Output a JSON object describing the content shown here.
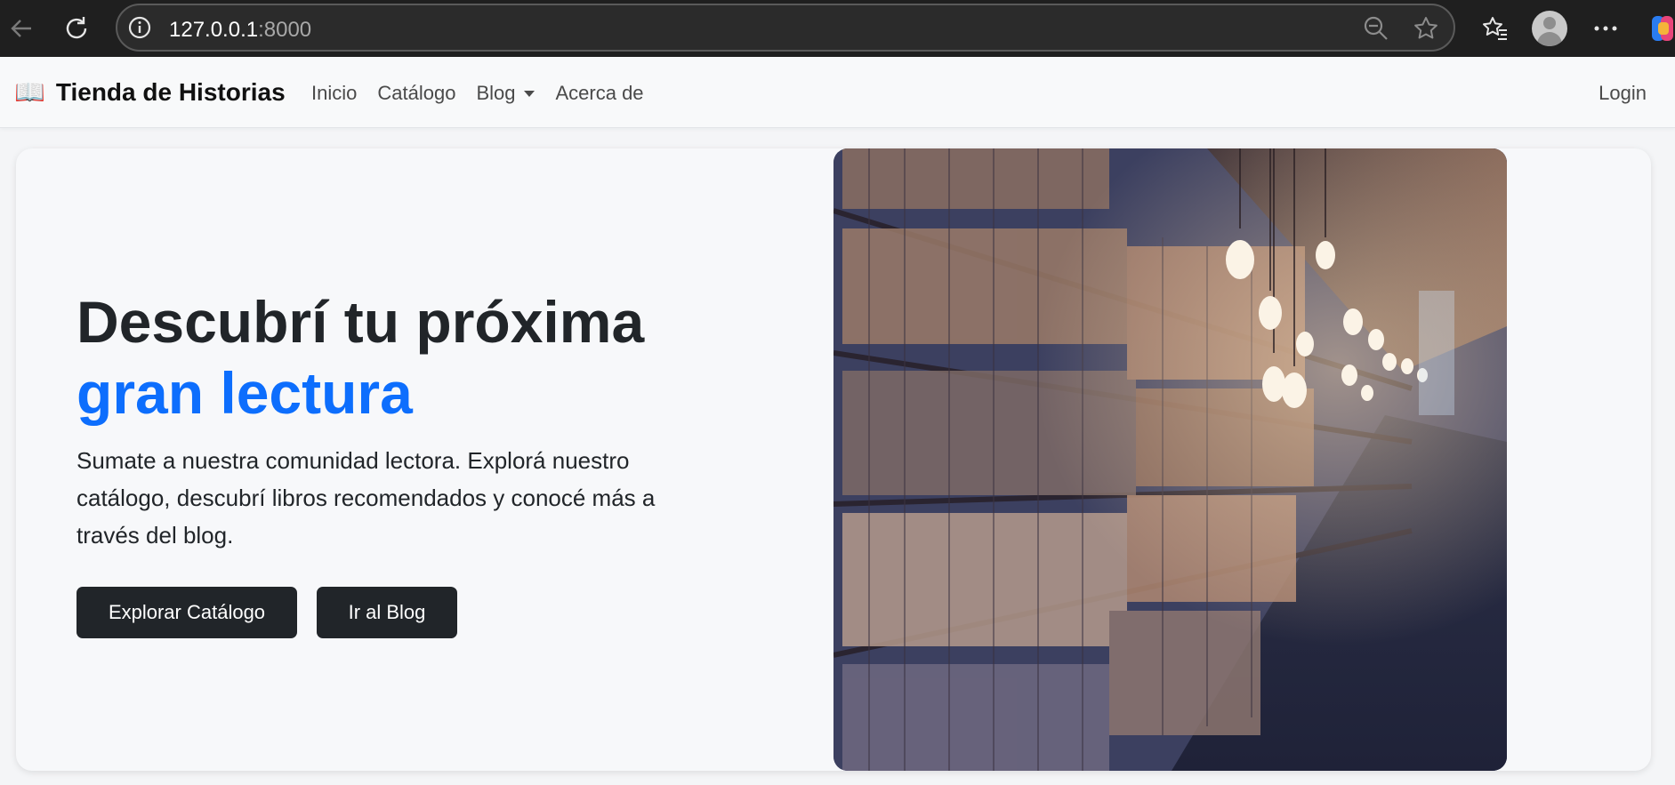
{
  "browser": {
    "url_host": "127.0.0.1",
    "url_port": ":8000",
    "icons": [
      "back-icon",
      "reload-icon",
      "info-icon",
      "zoom-out-icon",
      "star-icon",
      "favorites-icon",
      "profile-icon",
      "more-icon",
      "copilot-icon"
    ]
  },
  "navbar": {
    "brand_icon": "📖",
    "brand": "Tienda de Historias",
    "links": [
      "Inicio",
      "Catálogo",
      "Blog",
      "Acerca de"
    ],
    "login": "Login"
  },
  "hero": {
    "headline": "Descubrí tu próxima",
    "headline_accent": "gran lectura",
    "lead": "Sumate a nuestra comunidad lectora. Explorá nuestro catálogo, descubrí libros recomendados y conocé más a través del blog.",
    "buttons": [
      "Explorar Catálogo",
      "Ir al Blog"
    ],
    "accent_color": "#0d6efd",
    "button_color": "#212529"
  }
}
